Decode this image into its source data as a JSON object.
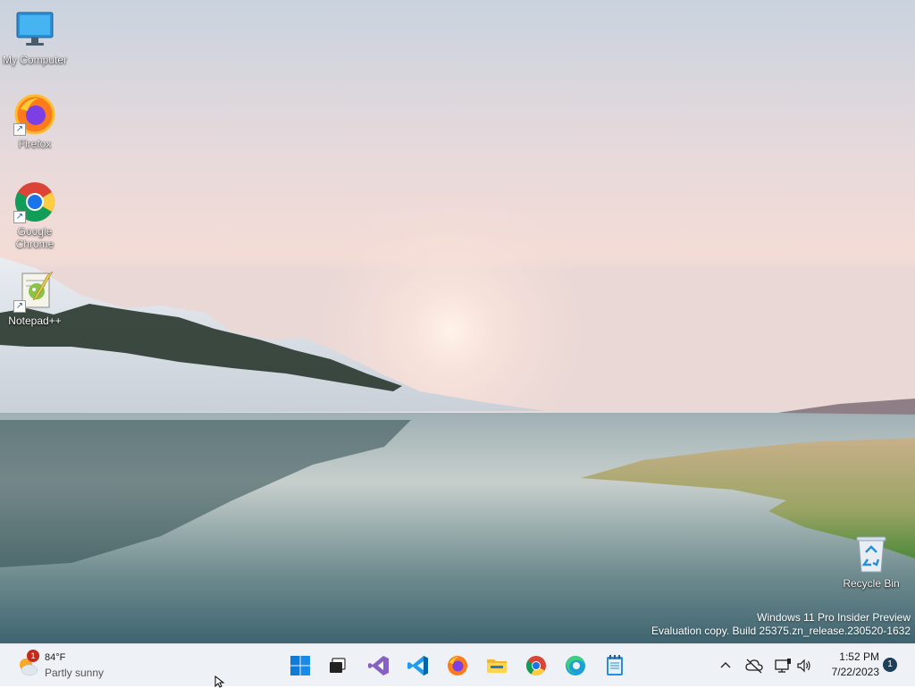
{
  "desktop": {
    "icons": [
      {
        "label": "My Computer",
        "icon": "monitor-icon"
      },
      {
        "label": "Firefox",
        "icon": "firefox-icon"
      },
      {
        "label": "Google Chrome",
        "icon": "chrome-icon"
      },
      {
        "label": "Notepad++",
        "icon": "notepadpp-icon"
      },
      {
        "label": "Recycle Bin",
        "icon": "recycle-bin-icon"
      }
    ],
    "watermark": {
      "line1": "Windows 11 Pro Insider Preview",
      "line2": "Evaluation copy. Build 25375.zn_release.230520-1632"
    }
  },
  "taskbar": {
    "weather": {
      "temp": "84°F",
      "desc": "Partly sunny",
      "badge": "1"
    },
    "apps": [
      {
        "name": "Start",
        "icon": "windows-start-icon"
      },
      {
        "name": "Task View",
        "icon": "task-view-icon"
      },
      {
        "name": "Visual Studio",
        "icon": "visual-studio-icon"
      },
      {
        "name": "Visual Studio Code",
        "icon": "vscode-icon"
      },
      {
        "name": "Firefox",
        "icon": "firefox-icon"
      },
      {
        "name": "File Explorer",
        "icon": "file-explorer-icon"
      },
      {
        "name": "Google Chrome",
        "icon": "chrome-icon"
      },
      {
        "name": "Microsoft Edge",
        "icon": "edge-icon"
      },
      {
        "name": "Notepad",
        "icon": "notepad-icon"
      }
    ],
    "tray": {
      "icons": [
        "chevron-up-icon",
        "cloud-offline-icon",
        "network-icon",
        "volume-icon"
      ],
      "time": "1:52 PM",
      "date": "7/22/2023",
      "notifications": "1"
    }
  }
}
